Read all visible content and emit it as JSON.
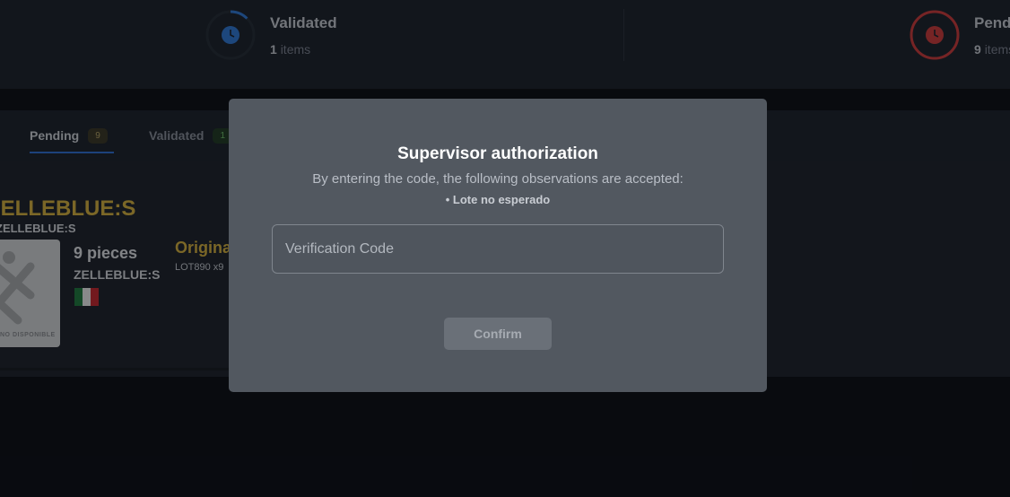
{
  "stats": {
    "validated": {
      "title": "Validated",
      "count": "1",
      "unit": "items",
      "color": "#2f78d8"
    },
    "pending": {
      "title": "Pending",
      "count": "9",
      "unit": "items",
      "color": "#d03a3a"
    }
  },
  "tabs": [
    {
      "label": "Pending",
      "count": "9"
    },
    {
      "label": "Validated",
      "count": "1"
    }
  ],
  "product": {
    "title": "ZELLEBLUE:S",
    "code": "ZELLEBLUE:S",
    "image_caption": "NO DISPONIBLE",
    "pieces": "9 pieces",
    "brand": "ZELLEBLUE:S",
    "flag_icon": "mexico-flag-icon",
    "origin": "Original",
    "lot": "LOT890 x9"
  },
  "modal": {
    "title": "Supervisor authorization",
    "description": "By entering the code, the following observations are accepted:",
    "observation": "• Lote no esperado",
    "input_placeholder": "Verification Code",
    "confirm_label": "Confirm"
  }
}
